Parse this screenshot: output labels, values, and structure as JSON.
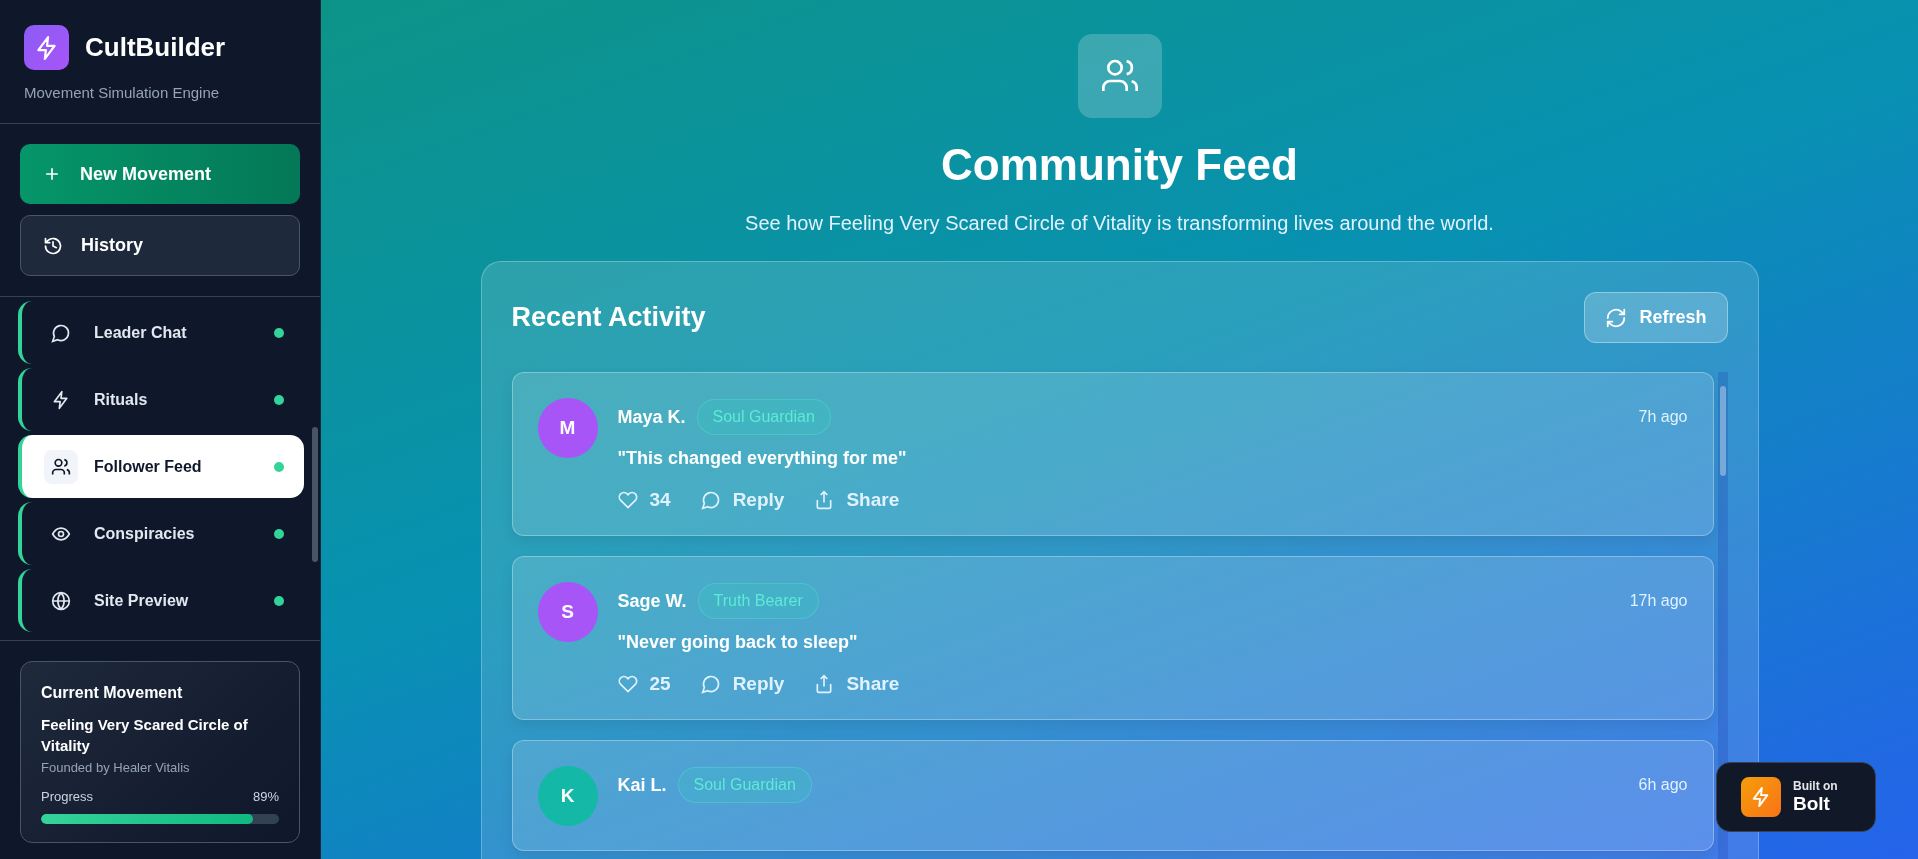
{
  "sidebar": {
    "app_name": "CultBuilder",
    "tagline": "Movement Simulation Engine",
    "new_button": "New Movement",
    "history_button": "History",
    "nav": [
      {
        "label": "Leader Chat",
        "kind": "chat",
        "selected": false
      },
      {
        "label": "Rituals",
        "kind": "bolt",
        "selected": false
      },
      {
        "label": "Follower Feed",
        "kind": "users",
        "selected": true
      },
      {
        "label": "Conspiracies",
        "kind": "eye",
        "selected": false
      },
      {
        "label": "Site Preview",
        "kind": "globe",
        "selected": false
      }
    ],
    "current": {
      "heading": "Current Movement",
      "name": "Feeling Very Scared Circle of Vitality",
      "founder": "Founded by Healer Vitalis",
      "progress_label": "Progress",
      "progress_value": "89%",
      "level": 0.89
    }
  },
  "header": {
    "title": "Community Feed",
    "subtitle": "See how Feeling Very Scared Circle of Vitality is transforming lives around the world."
  },
  "feed": {
    "title": "Recent Activity",
    "refresh": "Refresh",
    "posts": [
      {
        "initial": "M",
        "color": "#a855f7",
        "name": "Maya K.",
        "role": "Soul Guardian",
        "time": "7h ago",
        "quote": "\"This changed everything for me\"",
        "likes": "34",
        "reply": "Reply",
        "share": "Share"
      },
      {
        "initial": "S",
        "color": "#a855f7",
        "name": "Sage W.",
        "role": "Truth Bearer",
        "time": "17h ago",
        "quote": "\"Never going back to sleep\"",
        "likes": "25",
        "reply": "Reply",
        "share": "Share"
      },
      {
        "initial": "K",
        "color": "#14b8a6",
        "name": "Kai L.",
        "role": "Soul Guardian",
        "time": "6h ago"
      }
    ]
  },
  "badge": {
    "line1": "Built on",
    "line2": "Bolt"
  }
}
